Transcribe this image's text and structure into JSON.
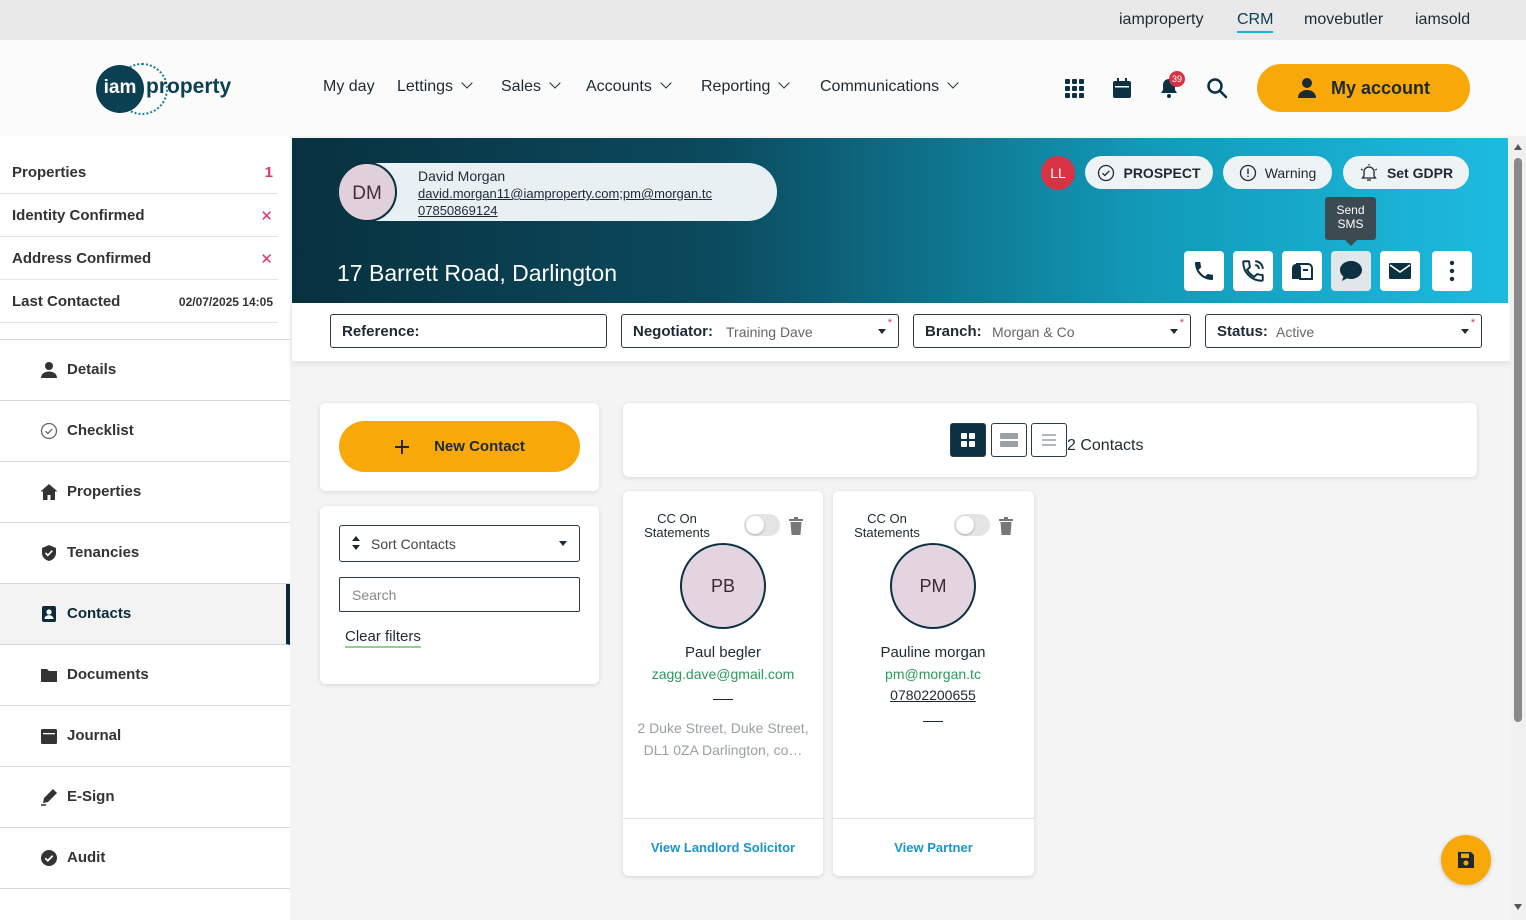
{
  "top_links": {
    "iamproperty": "iamproperty",
    "crm": "CRM",
    "movebutler": "movebutler",
    "iamsold": "iamsold"
  },
  "logo": {
    "circle": "iam",
    "text": "property"
  },
  "nav": {
    "my_day": "My day",
    "lettings": "Lettings",
    "sales": "Sales",
    "accounts": "Accounts",
    "reporting": "Reporting",
    "communications": "Communications"
  },
  "header_icons": {
    "notification_count": "39"
  },
  "my_account": "My account",
  "sidebar": {
    "stats": [
      {
        "label": "Properties",
        "value": "1"
      },
      {
        "label": "Identity Confirmed",
        "value": "✕"
      },
      {
        "label": "Address Confirmed",
        "value": "✕"
      },
      {
        "label": "Last Contacted",
        "value": "02/07/2025 14:05"
      }
    ],
    "menu": [
      {
        "label": "Details",
        "icon": "person-icon"
      },
      {
        "label": "Checklist",
        "icon": "check-circle-icon"
      },
      {
        "label": "Properties",
        "icon": "home-icon"
      },
      {
        "label": "Tenancies",
        "icon": "shield-icon"
      },
      {
        "label": "Contacts",
        "icon": "contact-card-icon"
      },
      {
        "label": "Documents",
        "icon": "folder-icon"
      },
      {
        "label": "Journal",
        "icon": "calendar-icon"
      },
      {
        "label": "E-Sign",
        "icon": "pen-icon"
      },
      {
        "label": "Audit",
        "icon": "check-badge-icon"
      }
    ]
  },
  "banner": {
    "initials": "DM",
    "name": "David Morgan",
    "email": "david.morgan11@iamproperty.com;pm@morgan.tc",
    "phone": "07850869124",
    "address": "17 Barrett Road, Darlington",
    "user_badge": "LL",
    "prospect": "PROSPECT",
    "warning": "Warning",
    "set_gdpr": "Set GDPR",
    "tooltip_line1": "Send",
    "tooltip_line2": "SMS"
  },
  "filters": {
    "reference_label": "Reference:",
    "reference_value": "",
    "negotiator_label": "Negotiator:",
    "negotiator_value": "Training Dave",
    "branch_label": "Branch:",
    "branch_value": "Morgan & Co",
    "status_label": "Status:",
    "status_value": "Active"
  },
  "left_panel": {
    "new_contact": "New Contact",
    "sort_value": "Sort Contacts",
    "search_placeholder": "Search",
    "clear_filters": "Clear filters"
  },
  "contacts_count": "2 Contacts",
  "contacts": [
    {
      "cc_label": "CC On Statements",
      "initials": "PB",
      "name": "Paul begler",
      "email": "zagg.dave@gmail.com",
      "phone": "",
      "address": "2 Duke Street, Duke Street, DL1 0ZA Darlington, co…",
      "action": "View Landlord Solicitor"
    },
    {
      "cc_label": "CC On Statements",
      "initials": "PM",
      "name": "Pauline morgan",
      "email": "pm@morgan.tc",
      "phone": "07802200655",
      "address": "",
      "action": "View Partner"
    }
  ],
  "colors": {
    "accent": "#f8a809",
    "primary_dark": "#0b3142",
    "banner_start": "#08313f",
    "banner_end": "#1dbbe0",
    "danger": "#e0336d",
    "link": "#1a95c8",
    "email_green": "#2c9a5a"
  }
}
